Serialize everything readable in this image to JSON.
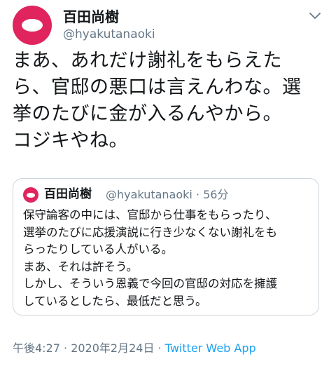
{
  "author": {
    "display_name": "百田尚樹",
    "handle": "@hyakutanaoki",
    "avatar_color": "#e0245e"
  },
  "tweet": {
    "lines": [
      "まあ、あれだけ謝礼をもらえた",
      "ら、官邸の悪口は言えんわな。選",
      "挙のたびに金が入るんやから。",
      "コジキやね。"
    ]
  },
  "quoted_tweet": {
    "display_name": "百田尚樹",
    "handle_time": "@hyakutanaoki · 56分",
    "lines": [
      "保守論客の中には、官邸から仕事をもらったり、",
      "選挙のたびに応援演説に行き少なくない謝礼をも",
      "らったりしている人がいる。",
      "まあ、それは許そう。",
      "しかし、そういう恩義で今回の官邸の対応を擁護",
      "しているとしたら、最低だと思う。"
    ]
  },
  "meta": {
    "timestamp": "午後4:27 · 2020年2月24日 · ",
    "source": "Twitter Web App"
  },
  "colors": {
    "text": "#14171a",
    "secondary": "#657786",
    "link": "#1da1f2",
    "border": "#ccd6dd"
  }
}
